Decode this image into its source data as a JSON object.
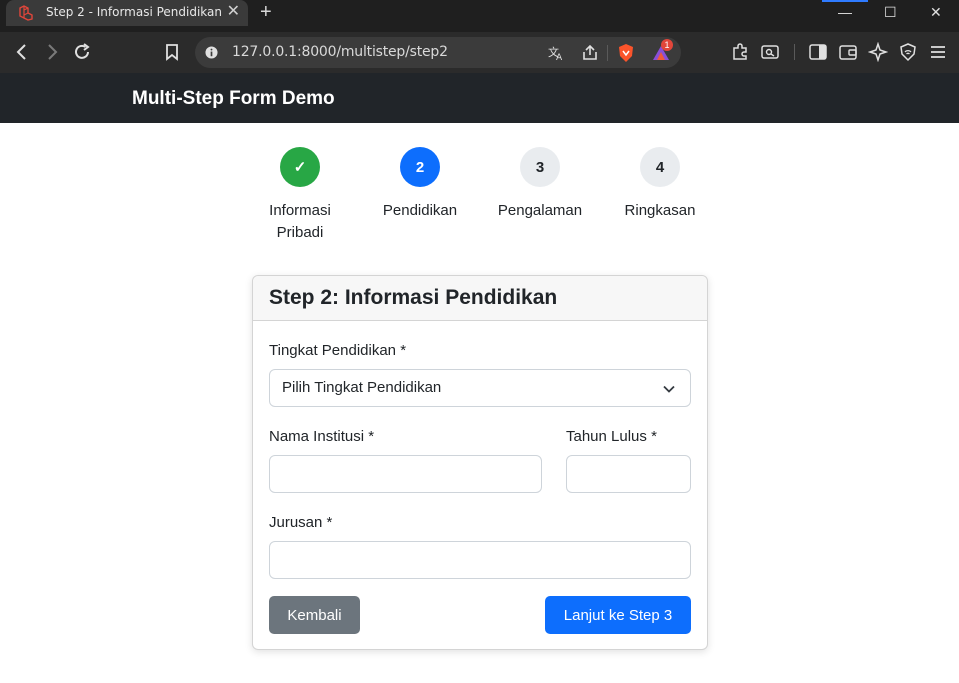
{
  "browser": {
    "tab_title": "Step 2 - Informasi Pendidikan",
    "tab_close": "✕",
    "new_tab": "+",
    "url": "127.0.0.1:8000/multistep/step2",
    "window_controls": {
      "minimize": "—",
      "maximize": "☐",
      "close": "✕"
    },
    "extension_badge": "1"
  },
  "navbar": {
    "brand": "Multi-Step Form Demo"
  },
  "steps": [
    {
      "number": "✓",
      "label": "Informasi Pribadi",
      "state": "done"
    },
    {
      "number": "2",
      "label": "Pendidikan",
      "state": "active"
    },
    {
      "number": "3",
      "label": "Pengalaman",
      "state": "pending"
    },
    {
      "number": "4",
      "label": "Ringkasan",
      "state": "pending"
    }
  ],
  "form": {
    "title": "Step 2: Informasi Pendidikan",
    "education_level": {
      "label": "Tingkat Pendidikan *",
      "selected": "Pilih Tingkat Pendidikan"
    },
    "institution": {
      "label": "Nama Institusi *",
      "value": ""
    },
    "graduation_year": {
      "label": "Tahun Lulus *",
      "value": ""
    },
    "major": {
      "label": "Jurusan *",
      "value": ""
    },
    "back_button": "Kembali",
    "next_button": "Lanjut ke Step 3"
  },
  "colors": {
    "done": "#28a745",
    "active": "#0d6efd",
    "pending": "#e9ecef",
    "navbar": "#212529",
    "secondary": "#6c757d"
  }
}
